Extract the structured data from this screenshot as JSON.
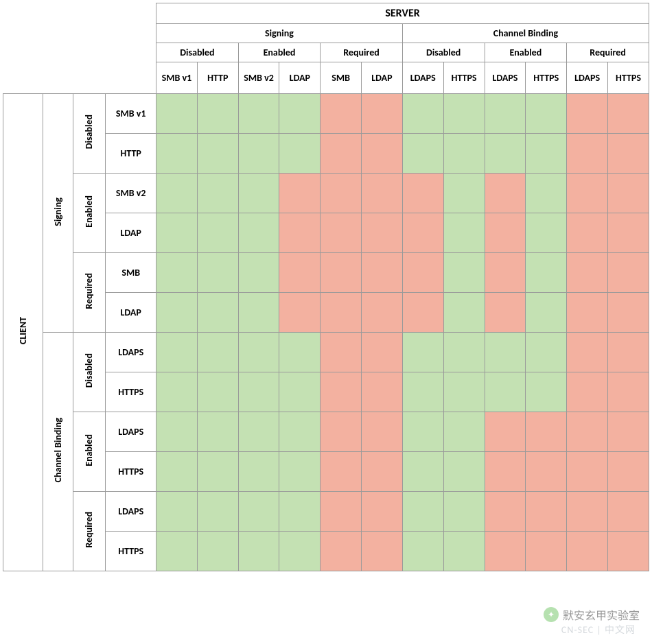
{
  "axis_server": "SERVER",
  "axis_client": "CLIENT",
  "cats": {
    "signing": "Signing",
    "cb": "Channel Binding"
  },
  "states": {
    "dis": "Disabled",
    "en": "Enabled",
    "req": "Required"
  },
  "server_cols": [
    "SMB v1",
    "HTTP",
    "SMB v2",
    "LDAP",
    "SMB",
    "LDAP",
    "LDAPS",
    "HTTPS",
    "LDAPS",
    "HTTPS",
    "LDAPS",
    "HTTPS"
  ],
  "client_rows": [
    "SMB v1",
    "HTTP",
    "SMB v2",
    "LDAP",
    "SMB",
    "LDAP",
    "LDAPS",
    "HTTPS",
    "LDAPS",
    "HTTPS",
    "LDAPS",
    "HTTPS"
  ],
  "watermark": "默安玄甲实验室",
  "watermark_sub": "CN-SEC | 中文网",
  "chart_data": {
    "type": "heatmap",
    "title": "",
    "xlabel": "SERVER",
    "ylabel": "CLIENT",
    "x_groups": [
      {
        "category": "Signing",
        "state": "Disabled",
        "protocols": [
          "SMB v1",
          "HTTP"
        ]
      },
      {
        "category": "Signing",
        "state": "Enabled",
        "protocols": [
          "SMB v2",
          "LDAP"
        ]
      },
      {
        "category": "Signing",
        "state": "Required",
        "protocols": [
          "SMB",
          "LDAP"
        ]
      },
      {
        "category": "Channel Binding",
        "state": "Disabled",
        "protocols": [
          "LDAPS",
          "HTTPS"
        ]
      },
      {
        "category": "Channel Binding",
        "state": "Enabled",
        "protocols": [
          "LDAPS",
          "HTTPS"
        ]
      },
      {
        "category": "Channel Binding",
        "state": "Required",
        "protocols": [
          "LDAPS",
          "HTTPS"
        ]
      }
    ],
    "y_groups": [
      {
        "category": "Signing",
        "state": "Disabled",
        "protocols": [
          "SMB v1",
          "HTTP"
        ]
      },
      {
        "category": "Signing",
        "state": "Enabled",
        "protocols": [
          "SMB v2",
          "LDAP"
        ]
      },
      {
        "category": "Signing",
        "state": "Required",
        "protocols": [
          "SMB",
          "LDAP"
        ]
      },
      {
        "category": "Channel Binding",
        "state": "Disabled",
        "protocols": [
          "LDAPS",
          "HTTPS"
        ]
      },
      {
        "category": "Channel Binding",
        "state": "Enabled",
        "protocols": [
          "LDAPS",
          "HTTPS"
        ]
      },
      {
        "category": "Channel Binding",
        "state": "Required",
        "protocols": [
          "LDAPS",
          "HTTPS"
        ]
      }
    ],
    "legend": {
      "1": "green (allowed/works)",
      "0": "red (blocked/fails)"
    },
    "colors": {
      "1": "#c4e1b3",
      "0": "#f3b1a0"
    },
    "matrix": [
      [
        1,
        1,
        1,
        1,
        0,
        0,
        1,
        1,
        1,
        1,
        0,
        0
      ],
      [
        1,
        1,
        1,
        1,
        0,
        0,
        1,
        1,
        1,
        1,
        0,
        0
      ],
      [
        1,
        1,
        1,
        0,
        0,
        0,
        0,
        1,
        0,
        1,
        0,
        0
      ],
      [
        1,
        1,
        1,
        0,
        0,
        0,
        0,
        1,
        0,
        1,
        0,
        0
      ],
      [
        1,
        1,
        1,
        0,
        0,
        0,
        0,
        1,
        0,
        1,
        0,
        0
      ],
      [
        1,
        1,
        1,
        0,
        0,
        0,
        0,
        1,
        0,
        1,
        0,
        0
      ],
      [
        1,
        1,
        1,
        1,
        0,
        0,
        1,
        1,
        1,
        1,
        0,
        0
      ],
      [
        1,
        1,
        1,
        1,
        0,
        0,
        1,
        1,
        1,
        1,
        0,
        0
      ],
      [
        1,
        1,
        1,
        1,
        0,
        0,
        1,
        1,
        0,
        0,
        0,
        0
      ],
      [
        1,
        1,
        1,
        1,
        0,
        0,
        1,
        1,
        0,
        0,
        0,
        0
      ],
      [
        1,
        1,
        1,
        1,
        0,
        0,
        1,
        1,
        0,
        0,
        0,
        0
      ],
      [
        1,
        1,
        1,
        1,
        0,
        0,
        1,
        1,
        0,
        0,
        0,
        0
      ]
    ]
  }
}
